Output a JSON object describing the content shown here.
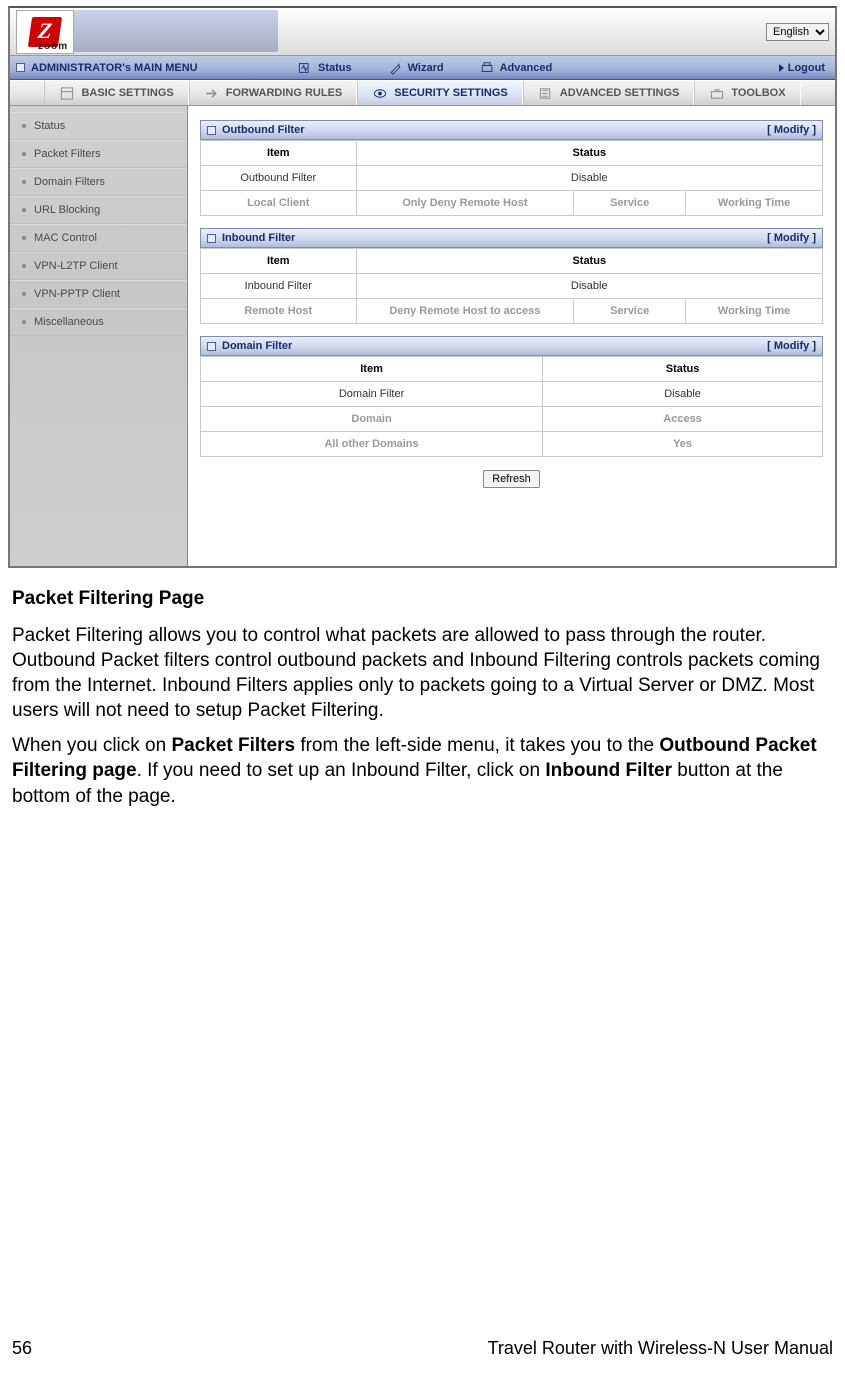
{
  "lang_selected": "English",
  "mainmenu": {
    "title": "ADMINISTRATOR's MAIN MENU",
    "items": [
      "Status",
      "Wizard",
      "Advanced"
    ],
    "logout": "Logout"
  },
  "subbar": {
    "items": [
      "BASIC SETTINGS",
      "FORWARDING RULES",
      "SECURITY SETTINGS",
      "ADVANCED SETTINGS",
      "TOOLBOX"
    ],
    "active_index": 2
  },
  "sidebar": {
    "items": [
      "Status",
      "Packet Filters",
      "Domain Filters",
      "URL Blocking",
      "MAC Control",
      "VPN-L2TP Client",
      "VPN-PPTP Client",
      "Miscellaneous"
    ]
  },
  "panels": [
    {
      "title": "Outbound Filter",
      "modify": "[ Modify ]",
      "head": [
        "Item",
        "Status"
      ],
      "row": [
        "Outbound Filter",
        "Disable"
      ],
      "dim": [
        "Local Client",
        "Only Deny Remote Host",
        "Service",
        "Working Time"
      ]
    },
    {
      "title": "Inbound Filter",
      "modify": "[ Modify ]",
      "head": [
        "Item",
        "Status"
      ],
      "row": [
        "Inbound Filter",
        "Disable"
      ],
      "dim": [
        "Remote Host",
        "Deny Remote Host to access",
        "Service",
        "Working Time"
      ]
    },
    {
      "title": "Domain Filter",
      "modify": "[ Modify ]",
      "head": [
        "Item",
        "Status"
      ],
      "row": [
        "Domain Filter",
        "Disable"
      ],
      "dimrows": [
        [
          "Domain",
          "Access"
        ],
        [
          "All other Domains",
          "Yes"
        ]
      ]
    }
  ],
  "refresh": "Refresh",
  "doc": {
    "h": "Packet Filtering Page",
    "p1": "Packet Filtering allows you to control what packets are allowed to pass through the router. Outbound Packet filters control outbound packets and Inbound Filtering controls packets coming from the Internet. Inbound Filters applies only to packets going to a Virtual Server or DMZ. Most users will not need to setup Packet Filtering.",
    "p2a": "When you click on ",
    "p2b": "Packet Filters",
    "p2c": " from the left-side menu, it takes you to the ",
    "p2d": "Outbound Packet Filtering page",
    "p2e": ". If you need to set up an Inbound Filter, click on ",
    "p2f": "Inbound Filter",
    "p2g": " button at the bottom of the page."
  },
  "footer": {
    "page": "56",
    "title": "Travel Router with Wireless-N User Manual"
  }
}
